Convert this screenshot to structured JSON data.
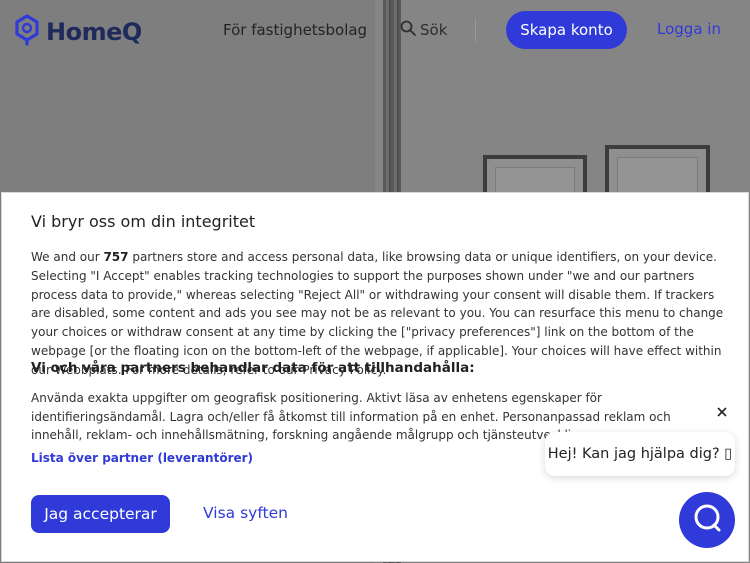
{
  "header": {
    "brand": "HomeQ",
    "nav_link": "För fastighetsbolag",
    "search_label": "Sök",
    "signup_label": "Skapa konto",
    "login_label": "Logga in"
  },
  "consent": {
    "title": "Vi bryr oss om din integritet",
    "intro_pre": "We and our ",
    "partner_count": "757",
    "intro_post": " partners store and access personal data, like browsing data or unique identifiers, on your device. Selecting \"I Accept\" enables tracking technologies to support the purposes shown under \"we and our partners process data to provide,\" whereas selecting \"Reject All\" or withdrawing your consent will disable them. If trackers are disabled, some content and ads you see may not be as relevant to you. You can resurface this menu to change your choices or withdraw consent at any time by clicking the [\"privacy preferences\"] link on the bottom of the webpage [or the floating icon on the bottom-left of the webpage, if applicable]. Your choices will have effect within our Webbplats. For more details, refer to our Privacy Policy.",
    "subtitle": "Vi och våra partners behandlar data för att tillhandahålla:",
    "purposes_text": "Använda exakta uppgifter om geografisk positionering. Aktivt läsa av enhetens egenskaper för identifieringsändamål. Lagra och/eller få åtkomst till information på en enhet. Personanpassad reklam och innehåll, reklam- och innehållsmätning, forskning angående målgrupp och tjänsteutveckling.",
    "partners_link": "Lista över partner (leverantörer)",
    "accept_label": "Jag accepterar",
    "purposes_label": "Visa syften"
  },
  "chat": {
    "greeting": "Hej! Kan jag hjälpa dig? ▯"
  },
  "colors": {
    "accent": "#2f3ad8",
    "brand_dark": "#1e2a5a"
  },
  "icons": [
    "homeq-logo-icon",
    "search-icon",
    "close-icon",
    "chat-icon"
  ]
}
